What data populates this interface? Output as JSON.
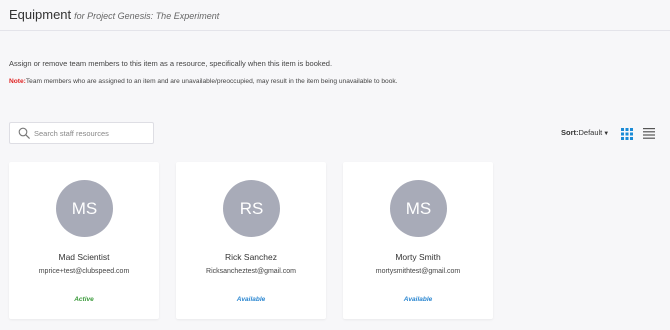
{
  "header": {
    "title": "Equipment",
    "subtitle": "for Project Genesis: The Experiment"
  },
  "description": "Assign or remove team members to this item as a resource, specifically when this item is booked.",
  "note": {
    "label": "Note:",
    "text": "Team members who are assigned to an item and are unavailable/preoccupied, may result in the item being unavailable to book."
  },
  "search": {
    "placeholder": "Search staff resources",
    "icon": "search-icon"
  },
  "sort": {
    "label": "Sort:",
    "value": "Default"
  },
  "view_toggles": {
    "grid_icon": "grid-view-icon",
    "list_icon": "list-view-icon",
    "active": "grid",
    "active_color": "#1a8bd6"
  },
  "cards": [
    {
      "initials": "MS",
      "name": "Mad Scientist",
      "email": "mprice+test@clubspeed.com",
      "status": "Active",
      "status_color": "#3a9a3a"
    },
    {
      "initials": "RS",
      "name": "Rick Sanchez",
      "email": "Ricksancheztest@gmail.com",
      "status": "Available",
      "status_color": "#2b87d1"
    },
    {
      "initials": "MS",
      "name": "Morty Smith",
      "email": "mortysmithtest@gmail.com",
      "status": "Available",
      "status_color": "#2b87d1"
    }
  ],
  "colors": {
    "avatar_bg": "#a8abb8",
    "note_label": "#e02424",
    "background": "#f7f7f9"
  }
}
